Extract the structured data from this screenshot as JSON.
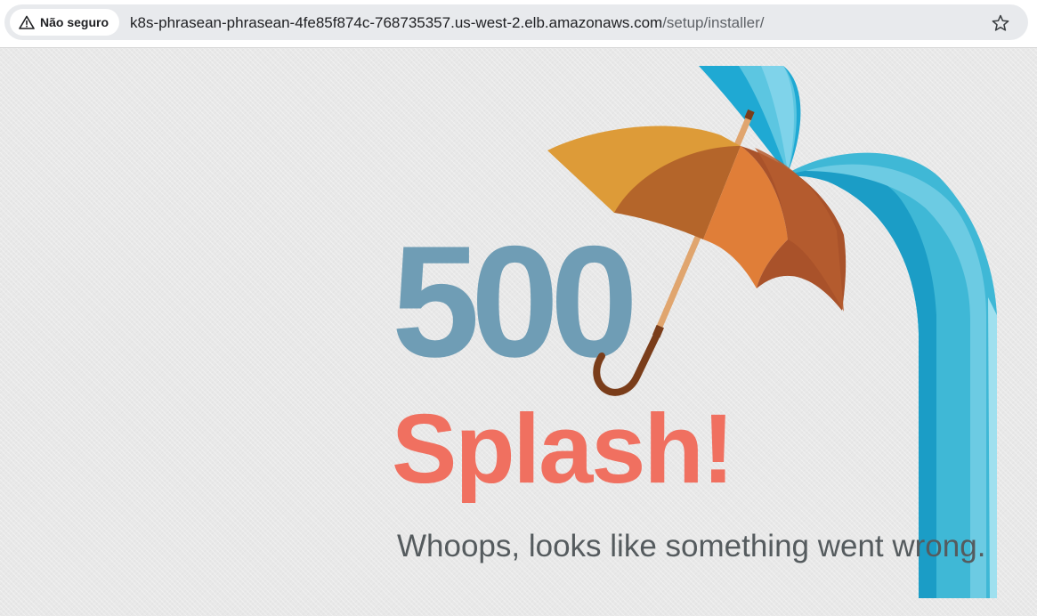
{
  "browser": {
    "security_label": "Não seguro",
    "url_host": "k8s-phrasean-phrasean-4fe85f874c-768735357.us-west-2.elb.amazonaws.com",
    "url_path": "/setup/installer/",
    "security_icon": "warning-triangle-icon",
    "bookmark_icon": "star-icon"
  },
  "error_page": {
    "code": "500",
    "headline": "Splash!",
    "message": "Whoops, looks like something went wrong."
  },
  "colors": {
    "code": "#6f9db5",
    "headline": "#f07060",
    "message": "#555b5e",
    "water": "#3fb8d6",
    "umbrella": "#d9822b"
  }
}
